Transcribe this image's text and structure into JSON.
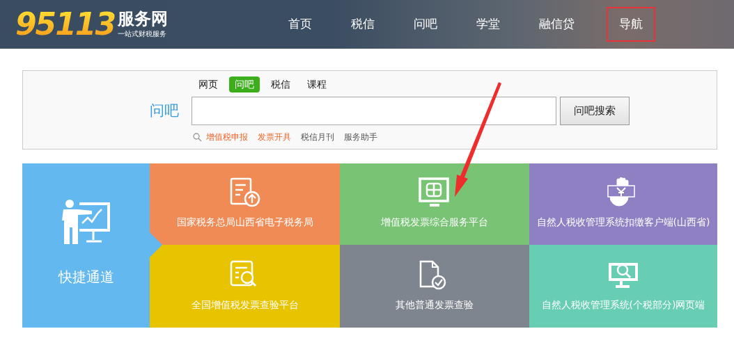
{
  "header": {
    "logo_number": "95113",
    "logo_title": "服务网",
    "logo_slogan": "一站式财税服务",
    "nav": [
      {
        "label": "首页",
        "highlighted": false
      },
      {
        "label": "税信",
        "highlighted": false
      },
      {
        "label": "问吧",
        "highlighted": false
      },
      {
        "label": "学堂",
        "highlighted": false
      },
      {
        "label": "融信贷",
        "highlighted": false
      },
      {
        "label": "导航",
        "highlighted": true
      }
    ]
  },
  "search": {
    "label": "问吧",
    "tabs": [
      {
        "label": "网页",
        "selected": false
      },
      {
        "label": "问吧",
        "selected": true
      },
      {
        "label": "税信",
        "selected": false
      },
      {
        "label": "课程",
        "selected": false
      }
    ],
    "button": "问吧搜索",
    "hot_links": [
      {
        "label": "增值税申报",
        "featured": true
      },
      {
        "label": "发票开具",
        "featured": true
      },
      {
        "label": "税信月刊",
        "featured": false
      },
      {
        "label": "服务助手",
        "featured": false
      }
    ]
  },
  "shortcuts": {
    "title": "快捷通道",
    "tiles": [
      {
        "label": "国家税务总局山西省电子税务局",
        "color": "#f18b56",
        "kind": "upload"
      },
      {
        "label": "增值税发票综合服务平台",
        "color": "#78c374",
        "kind": "monitor"
      },
      {
        "label": "自然人税收管理系统扣缴客户端(山西省)",
        "color": "#8f7fc3",
        "kind": "hand"
      },
      {
        "label": "全国增值税发票查验平台",
        "color": "#e8c300",
        "kind": "doc-search"
      },
      {
        "label": "其他普通发票查验",
        "color": "#7f858f",
        "kind": "doc-check"
      },
      {
        "label": "自然人税收管理系统(个税部分)网页端",
        "color": "#67cdb3",
        "kind": "screen-search"
      }
    ]
  }
}
